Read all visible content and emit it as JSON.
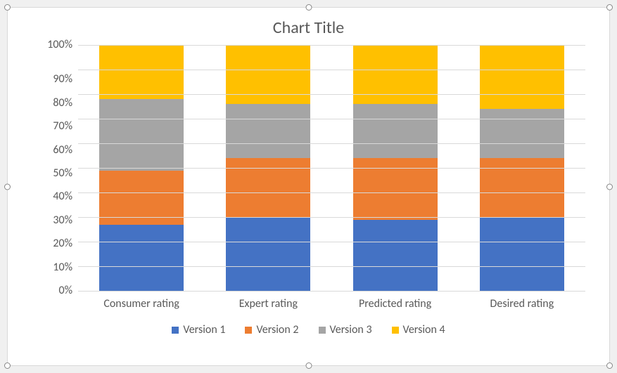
{
  "chart_data": {
    "type": "bar",
    "stacked": true,
    "percent_stacked": true,
    "title": "Chart Title",
    "xlabel": "",
    "ylabel": "",
    "ylim": [
      0,
      100
    ],
    "y_ticks": [
      "100%",
      "90%",
      "80%",
      "70%",
      "60%",
      "50%",
      "40%",
      "30%",
      "20%",
      "10%",
      "0%"
    ],
    "categories": [
      "Consumer rating",
      "Expert rating",
      "Predicted rating",
      "Desired rating"
    ],
    "series": [
      {
        "name": "Version 1",
        "color": "#4472C4",
        "values": [
          27,
          30,
          29,
          30
        ]
      },
      {
        "name": "Version 2",
        "color": "#ED7D31",
        "values": [
          22,
          24,
          25,
          24
        ]
      },
      {
        "name": "Version 3",
        "color": "#A5A5A5",
        "values": [
          29,
          22,
          22,
          20
        ]
      },
      {
        "name": "Version 4",
        "color": "#FFC000",
        "values": [
          22,
          24,
          24,
          26
        ]
      }
    ],
    "legend_labels": [
      "Version 1",
      "Version 2",
      "Version 3",
      "Version 4"
    ]
  }
}
